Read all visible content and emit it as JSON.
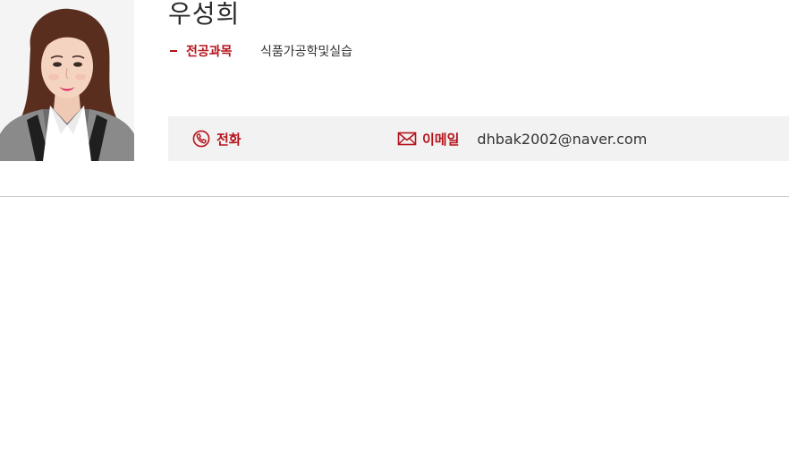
{
  "profile": {
    "name": "우성희",
    "major": {
      "label": "전공과목",
      "value": "식품가공학및실습"
    },
    "contact": {
      "phone": {
        "label": "전화",
        "value": "",
        "icon": "phone-icon"
      },
      "email": {
        "label": "이메일",
        "value": "dhbak2002@naver.com",
        "icon": "mail-icon"
      }
    }
  },
  "colors": {
    "accent": "#b5121b",
    "contact_bar_bg": "#f2f2f2",
    "divider": "#c8c8c8"
  }
}
